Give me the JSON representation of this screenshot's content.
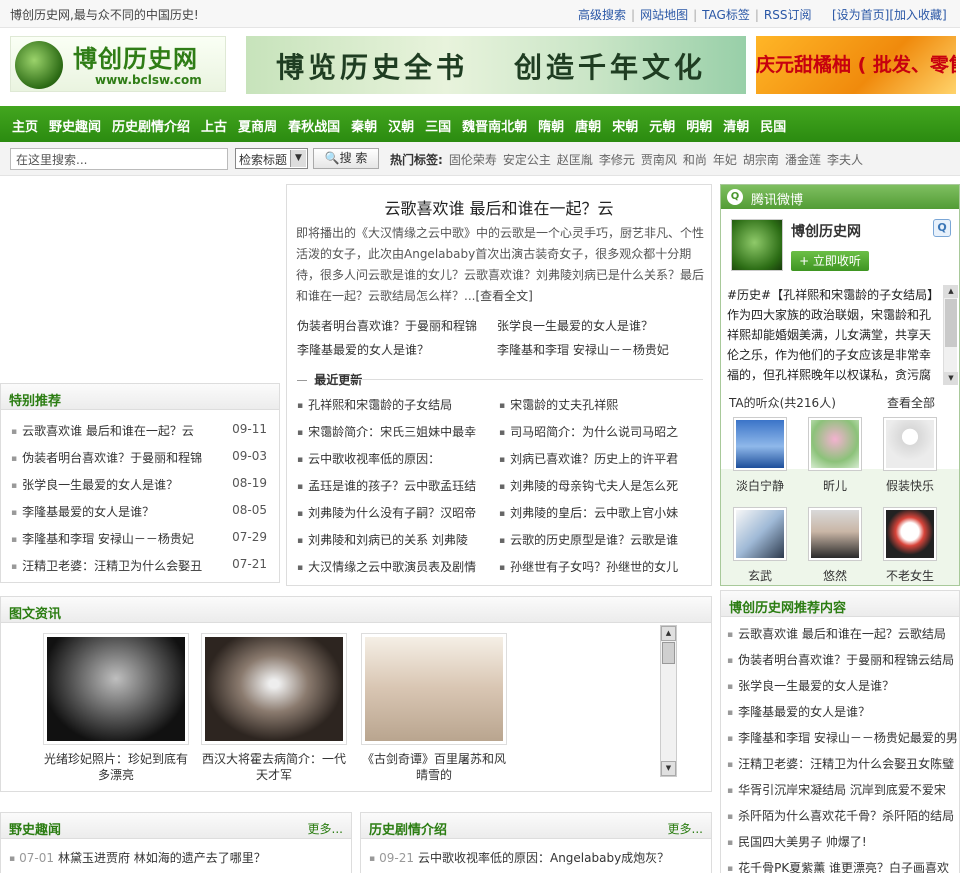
{
  "topbar": {
    "slogan": "博创历史网,最与众不同的中国历史!",
    "links": [
      "高级搜索",
      "网站地图",
      "TAG标签",
      "RSS订阅"
    ],
    "set_home": "[设为首页]",
    "add_fav": "[加入收藏]"
  },
  "header": {
    "logo_title": "博创历史网",
    "logo_url": "www.bclsw.com",
    "banner_left": "博览历史全书",
    "banner_right": "创造千年文化",
    "ad_text": "庆元甜橘柚 ( 批发、零售"
  },
  "nav": [
    "主页",
    "野史趣闻",
    "历史剧情介绍",
    "上古",
    "夏商周",
    "春秋战国",
    "秦朝",
    "汉朝",
    "三国",
    "魏晋南北朝",
    "隋朝",
    "唐朝",
    "宋朝",
    "元朝",
    "明朝",
    "清朝",
    "民国"
  ],
  "search": {
    "placeholder": "在这里搜索...",
    "select_value": "检索标题",
    "button": "搜 索",
    "hot_label": "热门标签:",
    "hot_tags": [
      "固伦荣寿",
      "安定公主",
      "赵匡胤",
      "李修元",
      "贾南风",
      "和尚",
      "年妃",
      "胡宗南",
      "潘金莲",
      "李夫人"
    ]
  },
  "headline": {
    "title": "云歌喜欢谁 最后和谁在一起？云",
    "summary": "即将播出的《大汉情缘之云中歌》中的云歌是一个心灵手巧，厨艺非凡、个性活泼的女子，此次由Angelababy首次出演古装奇女子，很多观众都十分期待，很多人问云歌是谁的女儿？云歌喜欢谁？刘弗陵刘病已是什么关系？最后和谁在一起？云歌结局怎么样？...",
    "more": "[查看全文]",
    "related": [
      [
        "伪装者明台喜欢谁？于曼丽和程锦",
        "张学良一生最爱的女人是谁？"
      ],
      [
        "李隆基最爱的女人是谁？",
        "李隆基和李瑁 安禄山－－杨贵妃"
      ]
    ],
    "recent_title": "最近更新",
    "recent": [
      [
        "孔祥熙和宋霭龄的子女结局",
        "宋霭龄的丈夫孔祥熙"
      ],
      [
        "宋霭龄简介：宋氏三姐妹中最幸",
        "司马昭简介：为什么说司马昭之"
      ],
      [
        "云中歌收视率低的原因：",
        "刘病已喜欢谁？历史上的许平君"
      ],
      [
        "孟珏是谁的孩子？云中歌孟珏结",
        "刘弗陵的母亲钩弋夫人是怎么死"
      ],
      [
        "刘弗陵为什么没有子嗣？汉昭帝",
        "刘弗陵的皇后：云中歌上官小妹"
      ],
      [
        "刘弗陵和刘病已的关系 刘弗陵",
        "云歌的历史原型是谁？云歌是谁"
      ],
      [
        "大汉情缘之云中歌演员表及剧情",
        "孙继世有子女吗？孙继世的女儿"
      ]
    ]
  },
  "special": {
    "title": "特别推荐",
    "items": [
      {
        "t": "云歌喜欢谁 最后和谁在一起？云",
        "d": "09-11"
      },
      {
        "t": "伪装者明台喜欢谁？于曼丽和程锦",
        "d": "09-03"
      },
      {
        "t": "张学良一生最爱的女人是谁？",
        "d": "08-19"
      },
      {
        "t": "李隆基最爱的女人是谁？",
        "d": "08-05"
      },
      {
        "t": "李隆基和李瑁 安禄山－－杨贵妃",
        "d": "07-29"
      },
      {
        "t": "汪精卫老婆：汪精卫为什么会娶丑",
        "d": "07-21"
      }
    ]
  },
  "imgnews": {
    "title": "图文资讯",
    "items": [
      {
        "caption": "光绪珍妃照片：珍妃到底有多漂亮"
      },
      {
        "caption": "西汉大将霍去病简介：一代天才军"
      },
      {
        "caption": "《古剑奇谭》百里屠苏和风晴雪的"
      }
    ]
  },
  "yeshi": {
    "title": "野史趣闻",
    "more": "更多...",
    "date": "07-01",
    "text": "林黛玉进贾府 林如海的遗产去了哪里？"
  },
  "juqing": {
    "title": "历史剧情介绍",
    "more": "更多...",
    "date": "09-21",
    "text": "云中歌收视率低的原因：Angelababy成炮灰？"
  },
  "weibo": {
    "header": "腾讯微博",
    "name": "博创历史网",
    "follow": "+ 立即收听",
    "post": "#历史#【孔祥熙和宋霭龄的子女结局】作为四大家族的政治联姻，宋霭龄和孔祥熙却能婚姻美满，儿女满堂，共享天伦之乐，作为他们的子女应该是非常幸福的，但孔祥熙晚年以权谋私，贪污腐",
    "fans_label": "TA的听众(共216人)",
    "view_all": "查看全部",
    "fans": [
      "淡白宁静",
      "昕儿",
      "假装快乐",
      "玄武",
      "悠然",
      "不老女生"
    ]
  },
  "siterec": {
    "title": "博创历史网推荐内容",
    "items": [
      "云歌喜欢谁 最后和谁在一起？云歌结局",
      "伪装者明台喜欢谁？于曼丽和程锦云结局",
      "张学良一生最爱的女人是谁？",
      "李隆基最爱的女人是谁？",
      "李隆基和李瑁 安禄山－－杨贵妃最爱的男",
      "汪精卫老婆：汪精卫为什么会娶丑女陈璧",
      "华胥引沉岸宋凝结局 沉岸到底爱不爱宋",
      "杀阡陌为什么喜欢花千骨？杀阡陌的结局",
      "民国四大美男子 帅爆了!",
      "花千骨PK夏紫薰 谁更漂亮？白子画喜欢"
    ]
  }
}
